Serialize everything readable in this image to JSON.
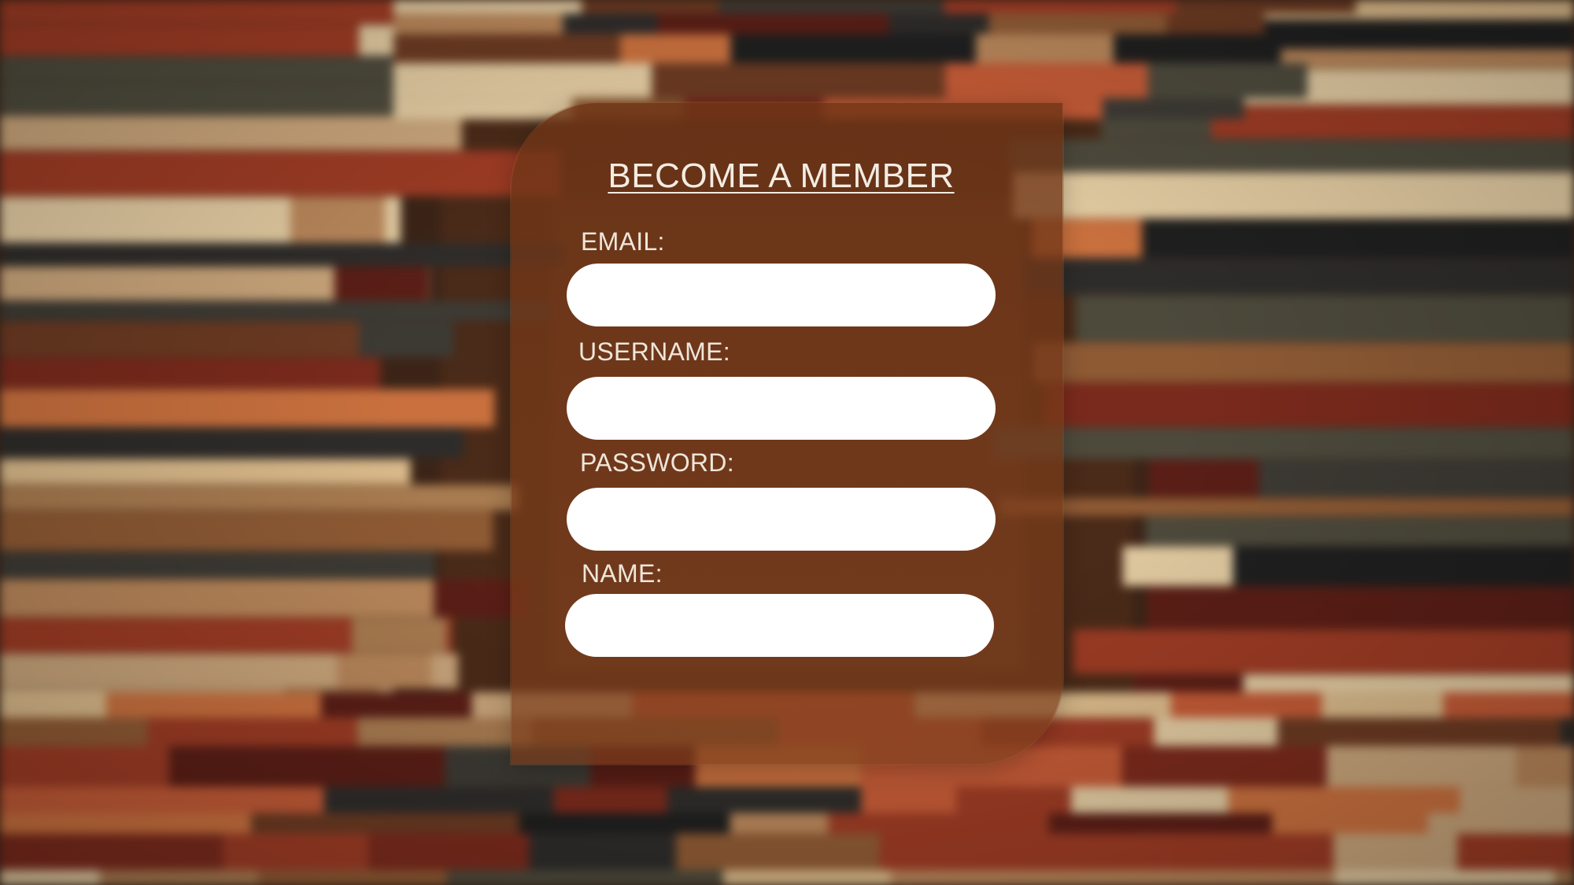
{
  "form": {
    "title": "BECOME A MEMBER",
    "fields": [
      {
        "label": "EMAIL:",
        "value": "",
        "placeholder": ""
      },
      {
        "label": "USERNAME:",
        "value": "",
        "placeholder": ""
      },
      {
        "label": "PASSWORD:",
        "value": "",
        "placeholder": ""
      },
      {
        "label": "NAME:",
        "value": "",
        "placeholder": ""
      }
    ]
  },
  "colors": {
    "panel": "#6e3416",
    "text": "#f4ece2",
    "input": "#ffffff"
  }
}
